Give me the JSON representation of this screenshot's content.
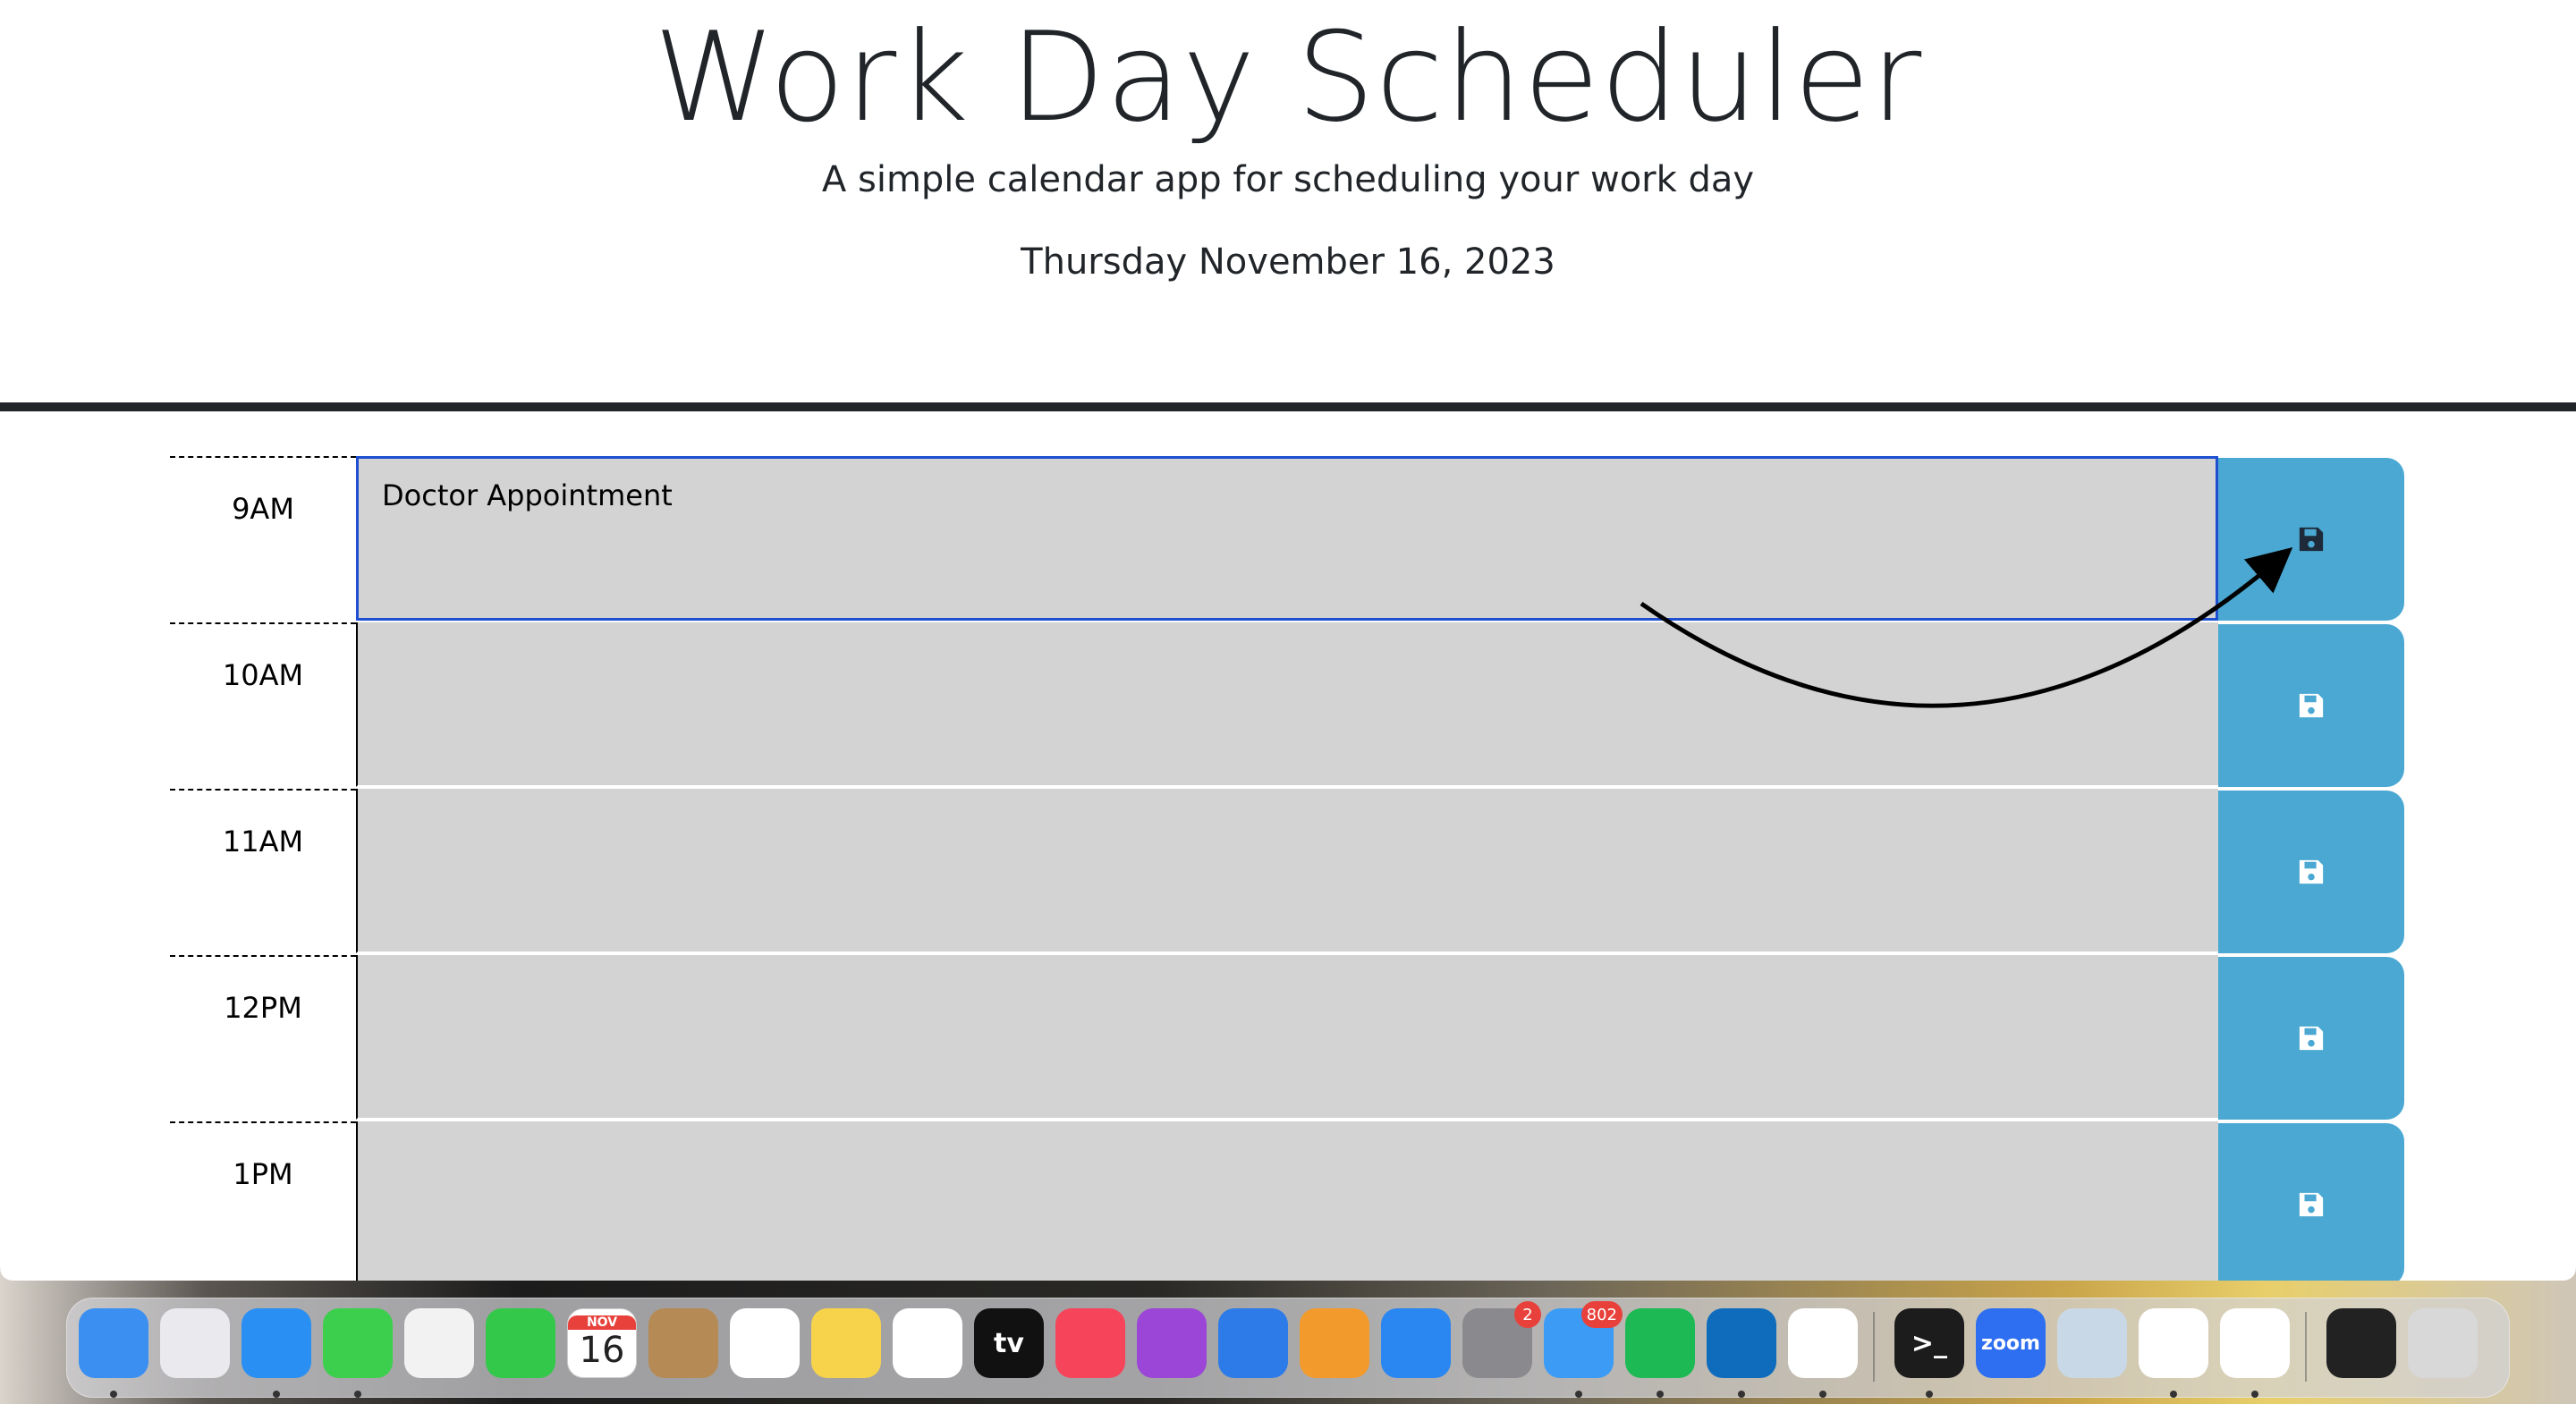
{
  "header": {
    "title": "Work Day Scheduler",
    "lead": "A simple calendar app for scheduling your work day",
    "current_date": "Thursday November 16, 2023"
  },
  "rows": [
    {
      "hour": "9AM",
      "text": "Doctor Appointment"
    },
    {
      "hour": "10AM",
      "text": ""
    },
    {
      "hour": "11AM",
      "text": ""
    },
    {
      "hour": "12PM",
      "text": ""
    },
    {
      "hour": "1PM",
      "text": ""
    }
  ],
  "colors": {
    "past_row": "#d3d3d3",
    "save_button": "#4aa8d2",
    "active_border": "#1f4fd1"
  },
  "dock": {
    "apps": [
      {
        "name": "finder-icon",
        "color": "#3b8ff0"
      },
      {
        "name": "launchpad-icon",
        "color": "#e9e9ee"
      },
      {
        "name": "safari-icon",
        "color": "#2a8ff2"
      },
      {
        "name": "messages-icon",
        "color": "#3ccf4e"
      },
      {
        "name": "photos-icon",
        "color": "#f2f2f2"
      },
      {
        "name": "facetime-icon",
        "color": "#33c84a"
      },
      {
        "name": "calendar-icon",
        "color": "#ffffff",
        "month": "NOV",
        "day": "16"
      },
      {
        "name": "contacts-icon",
        "color": "#b58a55"
      },
      {
        "name": "reminders-icon",
        "color": "#ffffff"
      },
      {
        "name": "notes-icon",
        "color": "#f7d34b"
      },
      {
        "name": "freeform-icon",
        "color": "#ffffff"
      },
      {
        "name": "apple-tv-icon",
        "color": "#111111",
        "label": "tv"
      },
      {
        "name": "music-icon",
        "color": "#f6455a"
      },
      {
        "name": "podcasts-icon",
        "color": "#9b46d6"
      },
      {
        "name": "keynote-icon",
        "color": "#2d7be8"
      },
      {
        "name": "pages-icon",
        "color": "#f29a2c"
      },
      {
        "name": "app-store-icon",
        "color": "#2a86f0"
      },
      {
        "name": "system-settings-icon",
        "color": "#8a8a8e",
        "badge": "2"
      },
      {
        "name": "mail-icon",
        "color": "#3b9bf5",
        "badge": "802"
      },
      {
        "name": "spotify-icon",
        "color": "#1db954"
      },
      {
        "name": "outlook-icon",
        "color": "#0f6cbd"
      },
      {
        "name": "chrome-icon",
        "color": "#ffffff"
      },
      {
        "name": "terminal-icon",
        "color": "#1c1c1c",
        "label": ">_"
      },
      {
        "name": "zoom-icon",
        "color": "#2d6ff0",
        "label": "zoom"
      },
      {
        "name": "preview-icon",
        "color": "#c9d8e6"
      },
      {
        "name": "slack-icon",
        "color": "#ffffff"
      },
      {
        "name": "vscode-icon",
        "color": "#ffffff"
      },
      {
        "name": "vscode-window-icon",
        "color": "#222222"
      },
      {
        "name": "trash-icon",
        "color": "#d8d8d8"
      }
    ]
  }
}
